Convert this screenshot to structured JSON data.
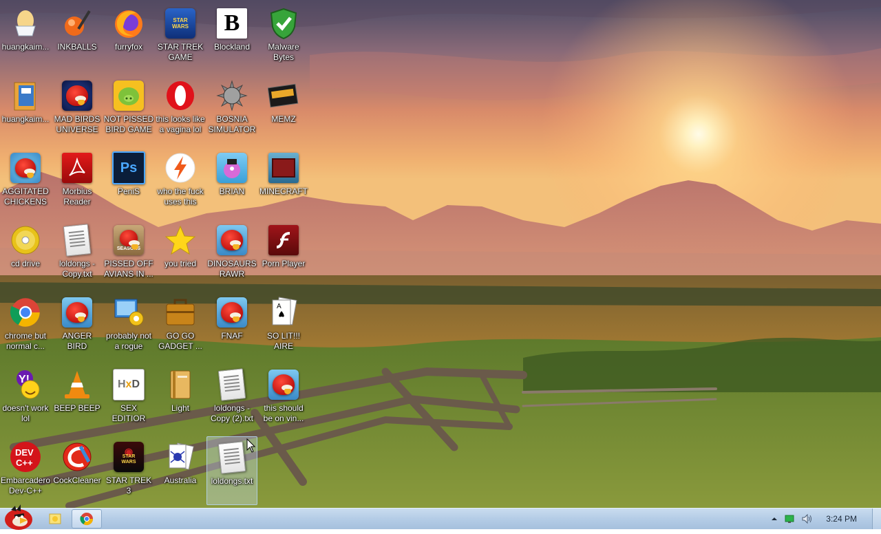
{
  "desktop": {
    "icons": [
      {
        "label": "huangkaim...",
        "icon": "egg-icon"
      },
      {
        "label": "INKBALLS",
        "icon": "inkball-icon"
      },
      {
        "label": "furryfox",
        "icon": "firefox-icon"
      },
      {
        "label": "STAR TREK GAME",
        "icon": "star-trek-game-icon"
      },
      {
        "label": "Blockland",
        "icon": "blockland-icon"
      },
      {
        "label": "Malware Bytes",
        "icon": "shield-check-icon"
      },
      {
        "label": "huangkaim...",
        "icon": "folder-book-icon"
      },
      {
        "label": "MAD BIRDS UNIVERSE",
        "icon": "angry-birds-space-icon"
      },
      {
        "label": "NOT PISSED BIRD GAME",
        "icon": "pig-game-icon"
      },
      {
        "label": "this looks like a vagina lol",
        "icon": "opera-icon"
      },
      {
        "label": "BOSNIA SIMULATOR",
        "icon": "spiked-ball-icon"
      },
      {
        "label": "MEMZ",
        "icon": "memz-icon"
      },
      {
        "label": "AGGITATED CHICKENS I...",
        "icon": "angry-birds-stella-icon"
      },
      {
        "label": "Morbius Reader",
        "icon": "pdf-reader-icon"
      },
      {
        "label": "PeniS",
        "icon": "photoshop-icon"
      },
      {
        "label": "who the fuck uses this",
        "icon": "lightning-app-icon"
      },
      {
        "label": "BRIAN",
        "icon": "angry-birds-rio-icon"
      },
      {
        "label": "MINECRAFT",
        "icon": "minecraft-icon"
      },
      {
        "label": "cd drive",
        "icon": "cd-drive-icon"
      },
      {
        "label": "loldongs - Copy.txt",
        "icon": "text-file-icon"
      },
      {
        "label": "PISSED OFF AVIANS IN ...",
        "icon": "angry-birds-seasons-icon"
      },
      {
        "label": "you tried",
        "icon": "star-icon"
      },
      {
        "label": "DINOSAURS RAWR",
        "icon": "angry-bird-icon"
      },
      {
        "label": "Porn Player",
        "icon": "flash-player-icon"
      },
      {
        "label": "chrome but normal c...",
        "icon": "chrome-icon"
      },
      {
        "label": "ANGER BIRD",
        "icon": "angry-bird-icon"
      },
      {
        "label": "probably not a rogue",
        "icon": "computer-gears-icon"
      },
      {
        "label": "GO GO GADGET ...",
        "icon": "briefcase-icon"
      },
      {
        "label": "FNAF",
        "icon": "angry-bird-icon"
      },
      {
        "label": "SO LIT!!! AIRE",
        "icon": "solitaire-cards-icon"
      },
      {
        "label": "doesn't work lol",
        "icon": "yahoo-messenger-icon"
      },
      {
        "label": "BEEP BEEP",
        "icon": "vlc-cone-icon"
      },
      {
        "label": "SEX EDITIOR",
        "icon": "hxd-editor-icon"
      },
      {
        "label": "Light",
        "icon": "book-icon"
      },
      {
        "label": "loldongs - Copy (2).txt",
        "icon": "text-file-icon"
      },
      {
        "label": "this should be on vin...",
        "icon": "angry-bird-icon"
      },
      {
        "label": "Embarcadero Dev-C++",
        "icon": "dev-cpp-icon"
      },
      {
        "label": "CockCleaner",
        "icon": "ccleaner-icon"
      },
      {
        "label": "STAR TREK 3",
        "icon": "star-wars-icon"
      },
      {
        "label": "Australia",
        "icon": "spider-solitaire-icon"
      },
      {
        "label": "loldongs.txt",
        "icon": "text-file-icon",
        "selected": true
      }
    ]
  },
  "taskbar": {
    "start_icon": "angry-bird-start-orb-icon",
    "pinned": [
      {
        "icon": "sticky-notes-icon"
      },
      {
        "icon": "chrome-icon",
        "active": true
      }
    ],
    "tray": {
      "show_hidden_icon": "chevron-up-icon",
      "network_icon": "network-icon",
      "volume_icon": "speaker-icon",
      "clock": "3:24 PM"
    }
  }
}
